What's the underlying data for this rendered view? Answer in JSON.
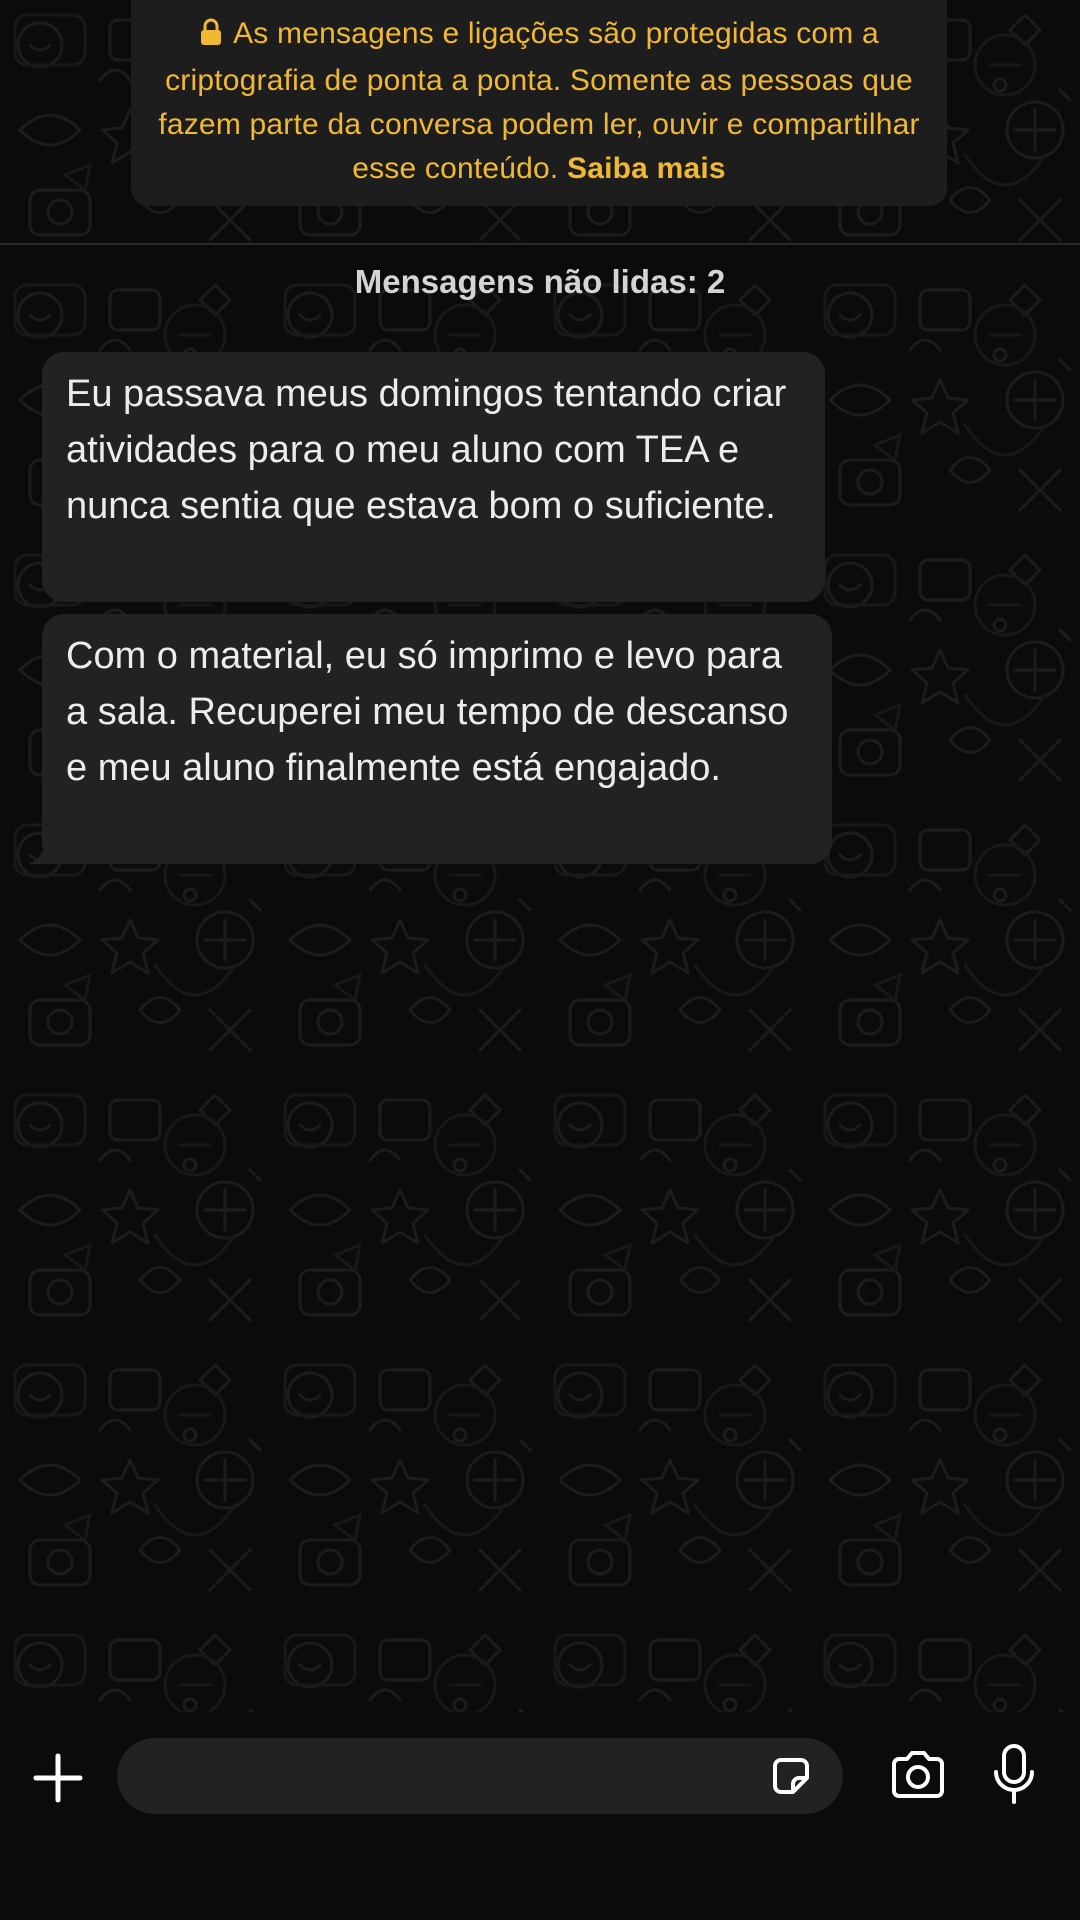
{
  "encryption_notice": {
    "text": "As mensagens e ligações são protegidas com a criptografia de ponta a ponta. Somente as pessoas que fazem parte da conversa podem ler, ouvir e compartilhar esse conteúdo.",
    "link_label": "Saiba mais",
    "icon": "lock-icon",
    "color": "#f0b833"
  },
  "unread_divider": {
    "label": "Mensagens não lidas: 2"
  },
  "messages": [
    {
      "direction": "incoming",
      "text": "Eu passava meus domingos tentando criar atividades para o meu aluno com TEA e nunca sentia que estava bom o suficiente."
    },
    {
      "direction": "incoming",
      "text": "Com o material, eu só imprimo e levo para a sala. Recuperei meu tempo de descanso e meu aluno finalmente está engajado."
    }
  ],
  "composer": {
    "value": "",
    "icons": {
      "attach": "plus-icon",
      "sticker": "sticker-icon",
      "camera": "camera-icon",
      "microphone": "microphone-icon"
    }
  },
  "theme": {
    "background": "#0b0b0b",
    "bubble": "#222222",
    "accent": "#f0b833"
  }
}
